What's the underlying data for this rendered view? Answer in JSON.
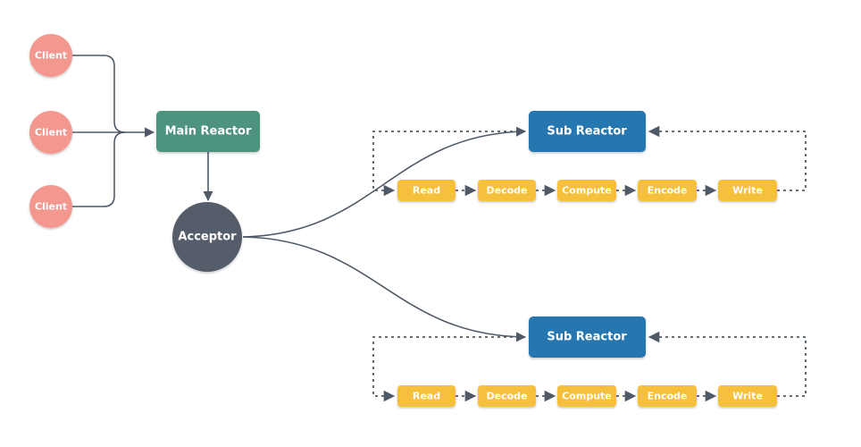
{
  "clients": [
    {
      "label": "Client"
    },
    {
      "label": "Client"
    },
    {
      "label": "Client"
    }
  ],
  "main_reactor": {
    "label": "Main Reactor"
  },
  "acceptor": {
    "label": "Acceptor"
  },
  "sub_reactors": [
    {
      "label": "Sub Reactor",
      "pipeline": [
        "Read",
        "Decode",
        "Compute",
        "Encode",
        "Write"
      ]
    },
    {
      "label": "Sub Reactor",
      "pipeline": [
        "Read",
        "Decode",
        "Compute",
        "Encode",
        "Write"
      ]
    }
  ],
  "colors": {
    "client": "#f4978e",
    "main_reactor": "#4e9380",
    "acceptor": "#555b6b",
    "sub_reactor": "#2677b0",
    "stage": "#f6c03d",
    "line": "#4f5a66"
  }
}
